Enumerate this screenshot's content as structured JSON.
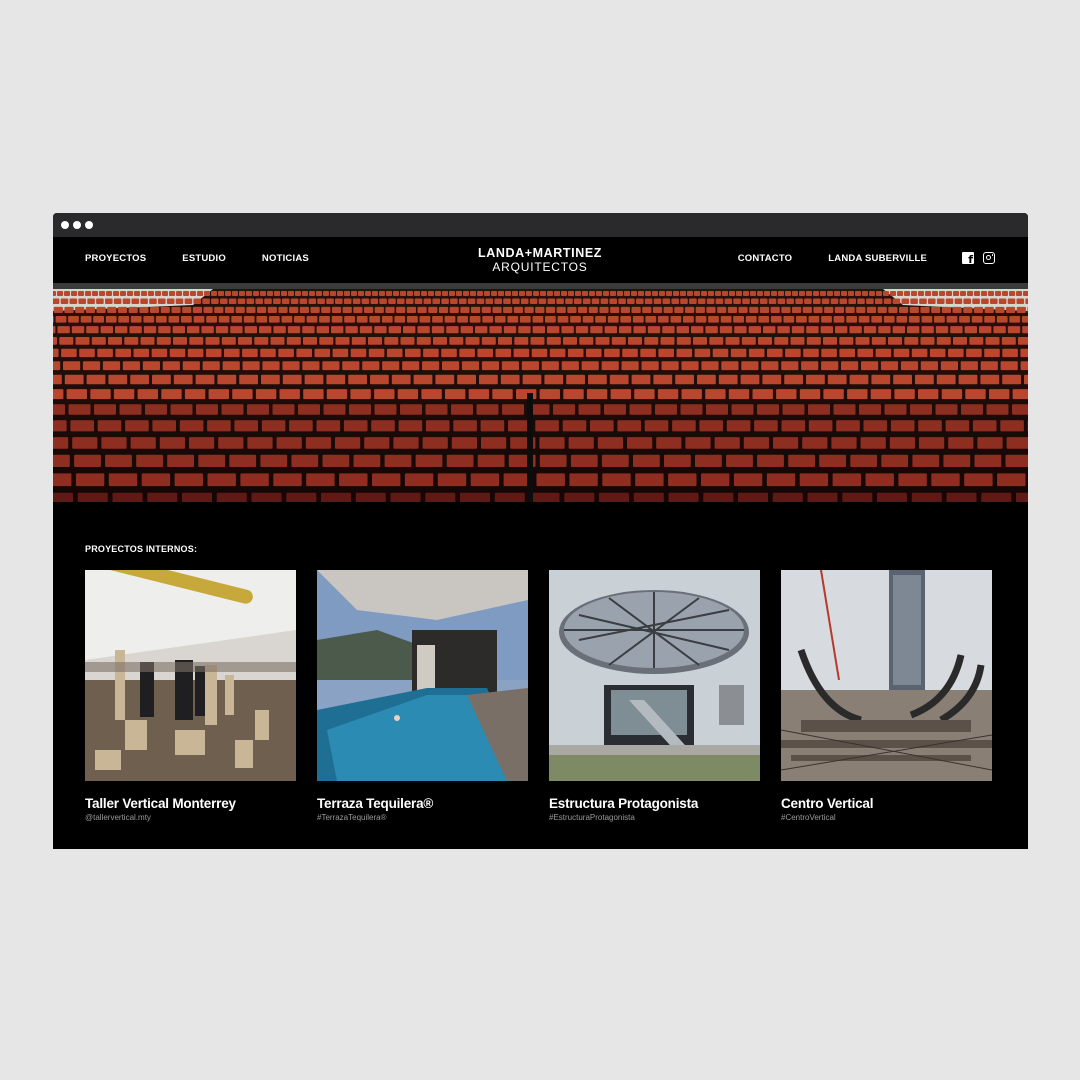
{
  "window": {
    "dots": 3
  },
  "nav": {
    "left": [
      "PROYECTOS",
      "ESTUDIO",
      "NOTICIAS"
    ],
    "logo_line1": "LANDA+MARTINEZ",
    "logo_line2": "ARQUITECTOS",
    "right": [
      "CONTACTO",
      "LANDA SUBERVILLE"
    ],
    "social": [
      "facebook-icon",
      "instagram-icon"
    ]
  },
  "hero": {
    "image": "auditorium-seats-photo"
  },
  "section": {
    "title": "PROYECTOS INTERNOS:",
    "cards": [
      {
        "title": "Taller Vertical Monterrey",
        "tag": "@tallervertical.mty",
        "image": "architecture-models-photo"
      },
      {
        "title": "Terraza Tequilera®",
        "tag": "#TerrazaTequilera®",
        "image": "rooftop-pool-photo"
      },
      {
        "title": "Estructura Protagonista",
        "tag": "#EstructuraProtagonista",
        "image": "glass-canopy-photo"
      },
      {
        "title": "Centro Vertical",
        "tag": "#CentroVertical",
        "image": "construction-site-photo"
      }
    ]
  },
  "colors": {
    "background": "#e6e6e6",
    "page": "#000000",
    "text": "#ffffff",
    "muted": "#9a9a9a",
    "seats": "#b8472e"
  }
}
